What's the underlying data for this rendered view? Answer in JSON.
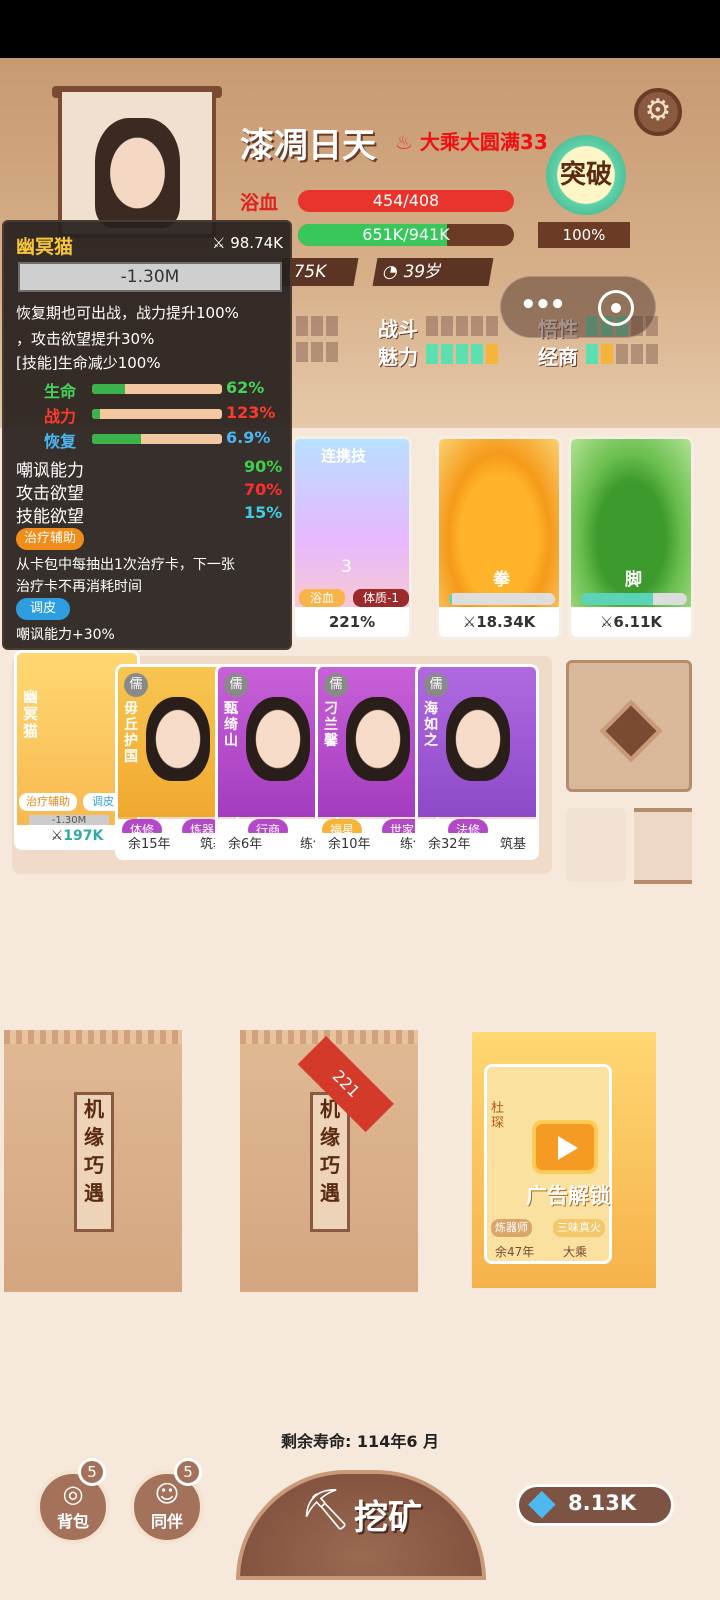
{
  "player": {
    "name": "漆凋日天",
    "realm": "大乘大圆满33",
    "hp_label": "浴血",
    "hp_text": "454/408",
    "exp_text": "651K/941K",
    "power": ".75K",
    "age": "39岁",
    "breakthrough_label": "突破",
    "breakthrough_pct": "100%"
  },
  "attributes": {
    "fight": "战斗",
    "charm": "魅力",
    "insight": "悟性",
    "business": "经商"
  },
  "pet": {
    "name": "幽冥猫",
    "power": "98.74K",
    "bar_value": "-1.30M",
    "desc1": "恢复期也可出战，战力提升100%",
    "desc2": "，攻击欲望提升30%",
    "desc3": "[技能]生命减少100%",
    "stats": [
      {
        "label": "生命",
        "value": "62%",
        "fill": 0.25,
        "color": "#45d45a"
      },
      {
        "label": "战力",
        "value": "123%",
        "fill": 0.1,
        "color": "#ff3a2a"
      },
      {
        "label": "恢复",
        "value": "6.9%",
        "fill": 0.38,
        "color": "#4ab6f0"
      }
    ],
    "traits": [
      {
        "label": "嘲讽能力",
        "value": "90%",
        "color": "#3fcf4a"
      },
      {
        "label": "攻击欲望",
        "value": "70%",
        "color": "#ff2f2f"
      },
      {
        "label": "技能欲望",
        "value": "15%",
        "color": "#3fd0e0"
      }
    ],
    "tag1": "治疗辅助",
    "tag1_desc": "从卡包中每抽出1次治疗卡，下一张",
    "tag1_desc2": "治疗卡不再消耗时间",
    "tag2": "调皮",
    "tag2_desc": "嘲讽能力+30%"
  },
  "cards": {
    "combo_title": "连携技",
    "combo_num": "3",
    "combo_tag1": "浴血",
    "combo_tag2": "体质-1",
    "combo_power": "221%",
    "fist_label": "拳",
    "fist_power": "18.34K",
    "kick_label": "脚",
    "kick_power": "6.11K"
  },
  "pet_card": {
    "name": "幽冥猫",
    "tag1": "治疗辅助",
    "tag2": "调皮",
    "bar": "-1.30M",
    "power": "197K"
  },
  "people": [
    {
      "name": "毋丘护国",
      "sect": "儒",
      "tag": "体修",
      "tag2": "炼器",
      "years": "余15年",
      "stage": "筑基"
    },
    {
      "name": "甄绮山",
      "sect": "儒",
      "tag": "行商",
      "tag2": "",
      "years": "余6年",
      "stage": "练气"
    },
    {
      "name": "刁兰馨",
      "sect": "儒",
      "tag": "福星",
      "tag2": "世家子",
      "years": "余10年",
      "stage": "练气"
    },
    {
      "name": "海如之",
      "sect": "儒",
      "tag": "法修",
      "tag2": "",
      "years": "余32年",
      "stage": "筑基"
    }
  ],
  "packs": {
    "title": "机缘巧遇",
    "ribbon": "221",
    "ad_name": "杜琛",
    "ad_label": "广告解锁",
    "ad_tag1": "炼器师",
    "ad_tag2": "三味真火",
    "ad_years": "余47年",
    "ad_stage": "大乘"
  },
  "lifespan": "剩余寿命: 114年6 月",
  "bottom": {
    "bag": "背包",
    "bag_badge": "5",
    "partner": "同伴",
    "partner_badge": "5",
    "mine": "挖矿",
    "currency": "8.13K"
  }
}
